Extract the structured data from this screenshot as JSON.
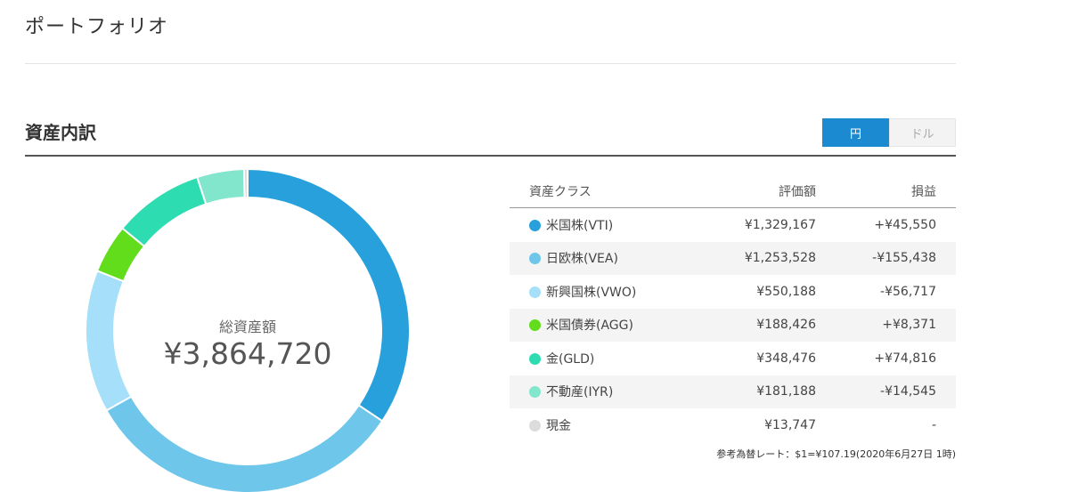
{
  "page_title": "ポートフォリオ",
  "section_title": "資産内訳",
  "currency_toggle": {
    "yen_label": "円",
    "dollar_label": "ドル",
    "selected": "円"
  },
  "summary": {
    "label": "総資産額",
    "total": "¥3,864,720"
  },
  "table": {
    "headers": {
      "asset_class": "資産クラス",
      "value": "評価額",
      "profit_loss": "損益"
    },
    "rows": [
      {
        "name": "米国株(VTI)",
        "value": "¥1,329,167",
        "profit_loss": "+¥45,550",
        "color": "#28a0dc",
        "pl_sign": "pos",
        "share": 1329167
      },
      {
        "name": "日欧株(VEA)",
        "value": "¥1,253,528",
        "profit_loss": "-¥155,438",
        "color": "#6ec6ea",
        "pl_sign": "neg",
        "share": 1253528
      },
      {
        "name": "新興国株(VWO)",
        "value": "¥550,188",
        "profit_loss": "-¥56,717",
        "color": "#a6dff9",
        "pl_sign": "neg",
        "share": 550188
      },
      {
        "name": "米国債券(AGG)",
        "value": "¥188,426",
        "profit_loss": "+¥8,371",
        "color": "#62dd1b",
        "pl_sign": "pos",
        "share": 188426
      },
      {
        "name": "金(GLD)",
        "value": "¥348,476",
        "profit_loss": "+¥74,816",
        "color": "#2edcb1",
        "pl_sign": "pos",
        "share": 348476
      },
      {
        "name": "不動産(IYR)",
        "value": "¥181,188",
        "profit_loss": "-¥14,545",
        "color": "#82e6cc",
        "pl_sign": "neg",
        "share": 181188
      },
      {
        "name": "現金",
        "value": "¥13,747",
        "profit_loss": "-",
        "color": "#dcdcdc",
        "pl_sign": "neu",
        "share": 13747
      }
    ]
  },
  "exchange_rate_note": "参考為替レート：$1=¥107.19(2020年6月27日 1時)"
}
